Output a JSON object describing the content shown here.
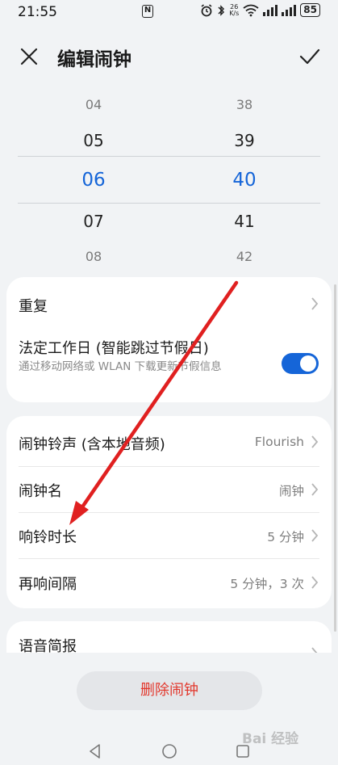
{
  "status_bar": {
    "time": "21:55",
    "nfc_glyph": "N",
    "net_speed_value": "26",
    "net_speed_unit": "K/s",
    "battery": "85",
    "icons": [
      "nfc-icon",
      "alarm-icon",
      "bluetooth-icon",
      "wifi-icon",
      "signal-icon",
      "battery-icon"
    ]
  },
  "header": {
    "title": "编辑闹钟",
    "close_icon": "close-icon",
    "confirm_icon": "check-icon"
  },
  "picker": {
    "hours": [
      "04",
      "05",
      "06",
      "07",
      "08"
    ],
    "minutes": [
      "38",
      "39",
      "40",
      "41",
      "42"
    ],
    "selected_index": 2,
    "selected_color": "#1565d8"
  },
  "card1": {
    "repeat_label": "重复",
    "holiday_label": "法定工作日 (智能跳过节假日)",
    "holiday_sub": "通过移动网络或 WLAN 下载更新节假信息",
    "holiday_toggle_on": true
  },
  "card2": {
    "rows": [
      {
        "label": "闹钟铃声 (含本地音频)",
        "value": "Flourish"
      },
      {
        "label": "闹钟名",
        "value": "闹钟"
      },
      {
        "label": "响铃时长",
        "value": "5 分钟"
      },
      {
        "label": "再响间隔",
        "value": "5 分钟，3 次"
      }
    ]
  },
  "card3": {
    "voice_label": "语音简报"
  },
  "delete_button": "删除闹钟",
  "accent_color": "#1565d8",
  "delete_color": "#e2382d",
  "annotation_color": "#e02020",
  "watermark": "Bai 经验"
}
